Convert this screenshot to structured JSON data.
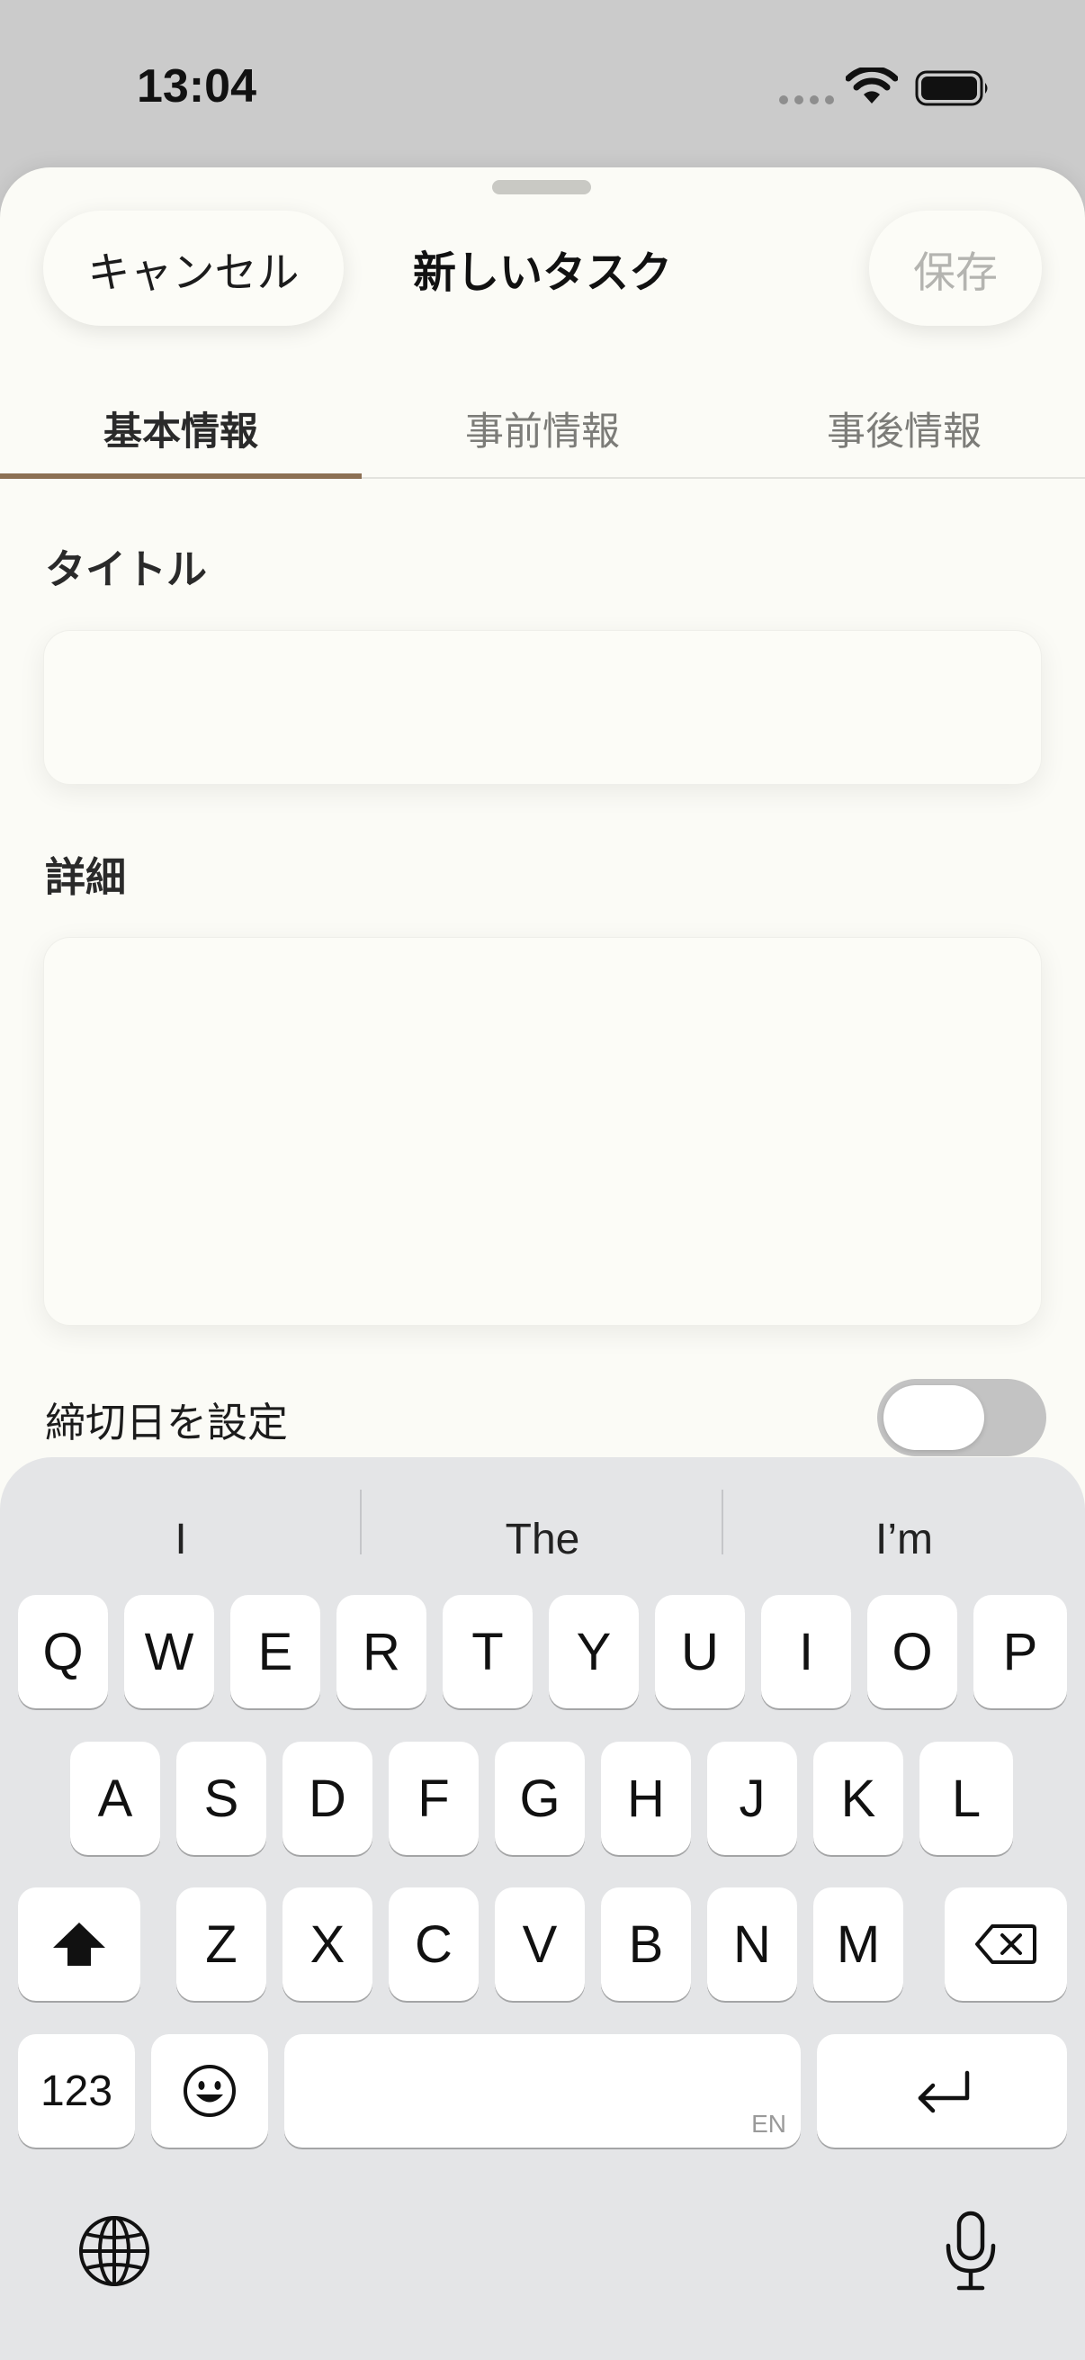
{
  "status_bar": {
    "time": "13:04",
    "icons": [
      "cellular-dots-icon",
      "wifi-icon",
      "battery-icon"
    ]
  },
  "sheet": {
    "title": "新しいタスク",
    "cancel_label": "キャンセル",
    "save_label": "保存",
    "colors": {
      "background": "#fbfbf6",
      "accent": "#8c7054",
      "disabled": "#b4b4b0"
    }
  },
  "tabs": [
    {
      "label": "基本情報",
      "active": true
    },
    {
      "label": "事前情報",
      "active": false
    },
    {
      "label": "事後情報",
      "active": false
    }
  ],
  "form": {
    "title_label": "タイトル",
    "title_value": "",
    "detail_label": "詳細",
    "detail_value": "",
    "deadline_label": "締切日を設定",
    "deadline_enabled": false
  },
  "keyboard": {
    "suggestions": [
      "I",
      "The",
      "I’m"
    ],
    "row1": [
      "Q",
      "W",
      "E",
      "R",
      "T",
      "Y",
      "U",
      "I",
      "O",
      "P"
    ],
    "row2": [
      "A",
      "S",
      "D",
      "F",
      "G",
      "H",
      "J",
      "K",
      "L"
    ],
    "row3": [
      "Z",
      "X",
      "C",
      "V",
      "B",
      "N",
      "M"
    ],
    "numbers_label": "123",
    "space_language": "EN",
    "special_icons": [
      "shift-icon",
      "backspace-icon",
      "emoji-icon",
      "return-icon",
      "globe-icon",
      "microphone-icon"
    ]
  }
}
